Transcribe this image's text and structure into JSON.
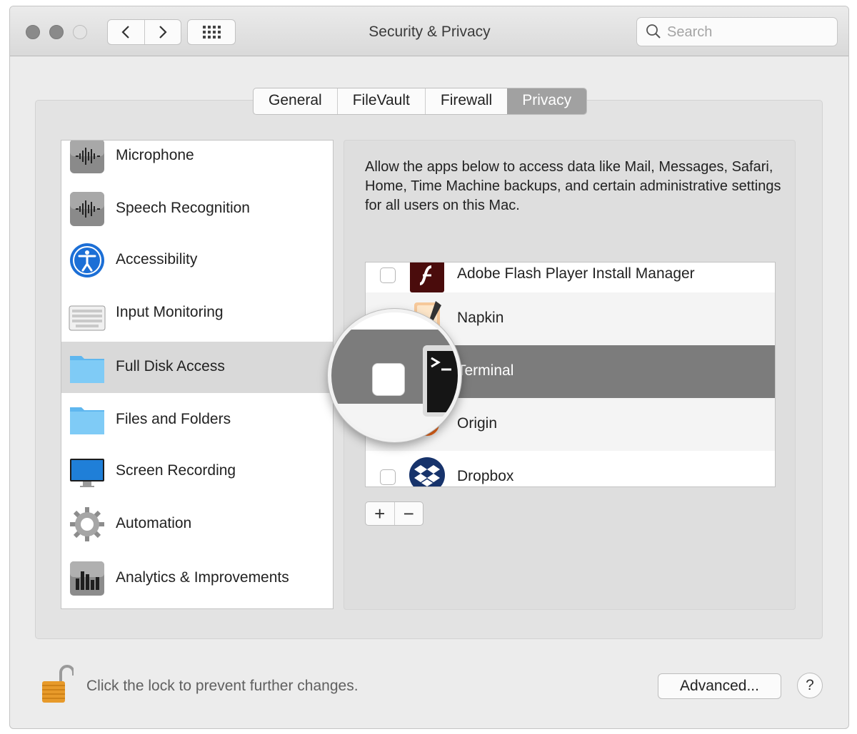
{
  "window": {
    "title": "Security & Privacy"
  },
  "toolbar": {
    "back": "‹",
    "forward": "›"
  },
  "search": {
    "placeholder": "Search"
  },
  "tabs": [
    {
      "label": "General",
      "active": false
    },
    {
      "label": "FileVault",
      "active": false
    },
    {
      "label": "Firewall",
      "active": false
    },
    {
      "label": "Privacy",
      "active": true
    }
  ],
  "sidebar": {
    "items": [
      {
        "label": "Microphone",
        "icon": "microphone-waveform-icon"
      },
      {
        "label": "Speech Recognition",
        "icon": "speech-waveform-icon"
      },
      {
        "label": "Accessibility",
        "icon": "accessibility-icon"
      },
      {
        "label": "Input Monitoring",
        "icon": "keyboard-icon"
      },
      {
        "label": "Full Disk Access",
        "icon": "folder-icon",
        "selected": true
      },
      {
        "label": "Files and Folders",
        "icon": "folder-icon"
      },
      {
        "label": "Screen Recording",
        "icon": "display-icon"
      },
      {
        "label": "Automation",
        "icon": "gear-icon"
      },
      {
        "label": "Analytics & Improvements",
        "icon": "bar-chart-icon"
      }
    ]
  },
  "main": {
    "description": "Allow the apps below to access data like Mail, Messages, Safari, Home, Time Machine backups, and certain administrative settings for all users on this Mac.",
    "apps": [
      {
        "label": "Adobe Flash Player Install Manager",
        "icon": "flash-icon",
        "checked": false
      },
      {
        "label": "Napkin",
        "icon": "napkin-icon",
        "checked": false
      },
      {
        "label": "Terminal",
        "icon": "terminal-icon",
        "checked": false,
        "selected": true
      },
      {
        "label": "Origin",
        "icon": "origin-icon",
        "checked": false
      },
      {
        "label": "Dropbox",
        "icon": "dropbox-icon",
        "checked": false
      }
    ],
    "add": "+",
    "remove": "−"
  },
  "footer": {
    "lock_text": "Click the lock to prevent further changes.",
    "advanced": "Advanced...",
    "help": "?"
  },
  "colors": {
    "selected_row": "#7c7c7c",
    "active_tab": "#a1a1a1"
  }
}
